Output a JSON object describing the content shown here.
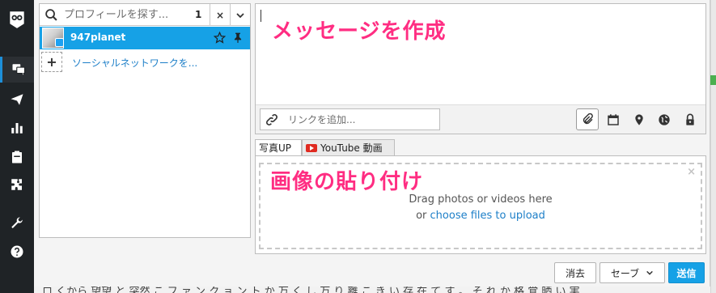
{
  "picker": {
    "search_placeholder": "プロフィールを探す...",
    "selected_count": "1",
    "clear_label": "×",
    "profile_name": "947planet",
    "add_label": "ソーシャルネットワークを..."
  },
  "editor": {
    "link_placeholder": "リンクを追加..."
  },
  "tabs": {
    "photo": "写真UP",
    "youtube": "YouTube 動画"
  },
  "upload": {
    "line1": "Drag photos or videos here",
    "line2_prefix": "or ",
    "line2_link": "choose files to upload",
    "close": "×"
  },
  "footer": {
    "discard": "消去",
    "save": "セーブ",
    "send": "送信"
  },
  "annotations": {
    "compose": "メッセージを作成",
    "paste_image": "画像の貼り付け"
  },
  "background": {
    "bottom_text": "ロ くから 望望 と 突然 こ フ ァ ン ク ョ ン ト か 万 く し 万 り 離 こ き い 存 在 て す 。 そ れ か 格 覚 晒 い 実"
  },
  "icons": {
    "rail": [
      "owl-logo-icon",
      "streams-icon",
      "publisher-icon",
      "analytics-icon",
      "assignments-icon",
      "apps-icon",
      "tools-icon",
      "help-icon"
    ],
    "accent": "#16a1e6",
    "annotation_color": "#ff2d82"
  }
}
